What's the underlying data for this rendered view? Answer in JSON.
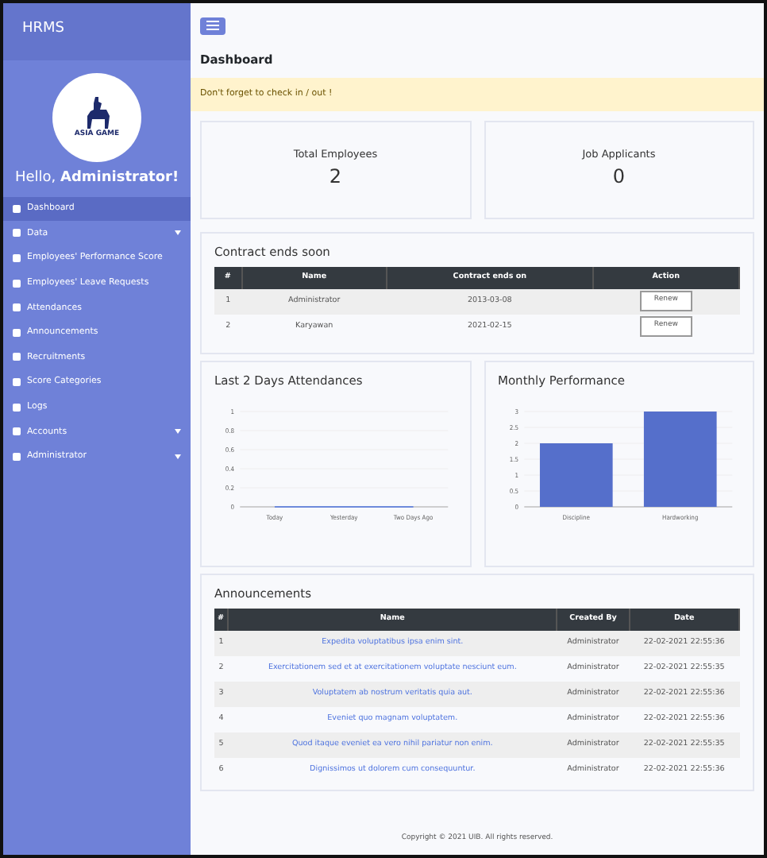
{
  "sidebar": {
    "brand": "HRMS",
    "logo_text": "ASIA GAME",
    "greeting": "Hello, ",
    "user": "Administrator!",
    "items": [
      {
        "label": "Dashboard",
        "selected": true,
        "expandable": false
      },
      {
        "label": "Data",
        "selected": false,
        "expandable": true
      },
      {
        "label": "Employees' Performance Score",
        "selected": false,
        "expandable": false
      },
      {
        "label": "Employees' Leave Requests",
        "selected": false,
        "expandable": false
      },
      {
        "label": "Attendances",
        "selected": false,
        "expandable": false
      },
      {
        "label": "Announcements",
        "selected": false,
        "expandable": false
      },
      {
        "label": "Recruitments",
        "selected": false,
        "expandable": false
      },
      {
        "label": "Score Categories",
        "selected": false,
        "expandable": false
      },
      {
        "label": "Logs",
        "selected": false,
        "expandable": false
      },
      {
        "label": "Accounts",
        "selected": false,
        "expandable": true
      },
      {
        "label": "Administrator",
        "selected": false,
        "expandable": true
      }
    ]
  },
  "page_title": "Dashboard",
  "alert": "Don't forget to check in / out !",
  "stats": [
    {
      "label": "Total Employees",
      "value": "2"
    },
    {
      "label": "Job Applicants",
      "value": "0"
    }
  ],
  "contracts": {
    "title": "Contract ends soon",
    "columns": [
      "#",
      "Name",
      "Contract ends on",
      "Action"
    ],
    "rows": [
      {
        "no": "1",
        "name": "Administrator",
        "date": "2013-03-08",
        "action": "Renew"
      },
      {
        "no": "2",
        "name": "Karyawan",
        "date": "2021-02-15",
        "action": "Renew"
      }
    ]
  },
  "attendance": {
    "title": "Last 2 Days Attendances",
    "chart_data": {
      "type": "line",
      "categories": [
        "Today",
        "Yesterday",
        "Two Days Ago"
      ],
      "series": [
        {
          "color": "#4e73df",
          "values": [
            0,
            0,
            0
          ]
        }
      ],
      "grid": true,
      "ylim": [
        0,
        1
      ],
      "yticks": [
        0,
        0.2,
        0.4,
        0.6,
        0.8,
        1
      ]
    }
  },
  "performance": {
    "title": "Monthly Performance",
    "chart_data": {
      "type": "bar",
      "categories": [
        "Discipline",
        "Hardworking"
      ],
      "series": [
        {
          "color": "#556fcb",
          "values": [
            2,
            3
          ]
        }
      ],
      "grid": true,
      "ylim": [
        0,
        3
      ],
      "yticks": [
        0,
        0.5,
        1,
        1.5,
        2,
        2.5,
        3
      ]
    }
  },
  "announcements": {
    "title": "Announcements",
    "columns": [
      "#",
      "Name",
      "Created By",
      "Date"
    ],
    "rows": [
      {
        "no": "1",
        "name": "Expedita voluptatibus ipsa enim sint.",
        "by": "Administrator",
        "date": "22-02-2021 22:55:36"
      },
      {
        "no": "2",
        "name": "Exercitationem sed et at exercitationem voluptate nesciunt eum.",
        "by": "Administrator",
        "date": "22-02-2021 22:55:35"
      },
      {
        "no": "3",
        "name": "Voluptatem ab nostrum veritatis quia aut.",
        "by": "Administrator",
        "date": "22-02-2021 22:55:36"
      },
      {
        "no": "4",
        "name": "Eveniet quo magnam voluptatem.",
        "by": "Administrator",
        "date": "22-02-2021 22:55:36"
      },
      {
        "no": "5",
        "name": "Quod itaque eveniet ea vero nihil pariatur non enim.",
        "by": "Administrator",
        "date": "22-02-2021 22:55:35"
      },
      {
        "no": "6",
        "name": "Dignissimos ut dolorem cum consequuntur.",
        "by": "Administrator",
        "date": "22-02-2021 22:55:36"
      }
    ]
  },
  "footer": "Copyright © 2021 UIB. All rights reserved."
}
